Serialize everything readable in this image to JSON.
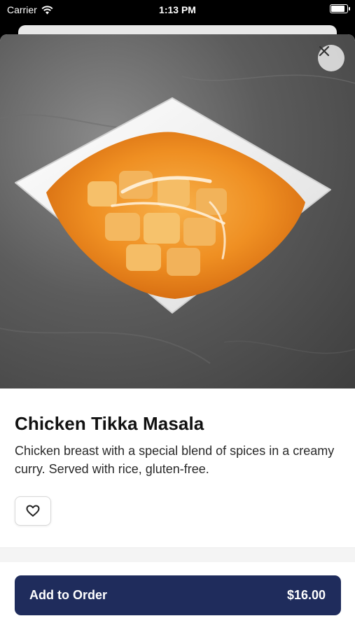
{
  "status_bar": {
    "carrier": "Carrier",
    "time": "1:13 PM",
    "wifi_icon": "wifi-icon",
    "battery_icon": "battery-icon"
  },
  "item": {
    "name": "Chicken Tikka Masala",
    "description": "Chicken breast with a special blend of spices in a creamy curry. Served with rice, gluten-free.",
    "image": "chicken-tikka-masala-photo"
  },
  "actions": {
    "close_icon": "close-icon",
    "favorite_icon": "heart-icon",
    "add_label": "Add to Order",
    "price": "$16.00"
  },
  "colors": {
    "primary_button": "#1f2c5c",
    "sheet_background": "#ffffff"
  }
}
